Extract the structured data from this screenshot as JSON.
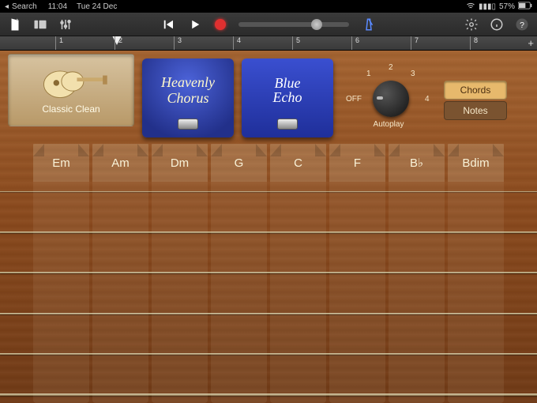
{
  "status": {
    "back": "Search",
    "time": "11:04",
    "date": "Tue 24 Dec",
    "battery": "57%"
  },
  "ruler": {
    "numbers": [
      "1",
      "2",
      "3",
      "4",
      "5",
      "6",
      "7",
      "8"
    ]
  },
  "instrument": {
    "name": "Classic Clean"
  },
  "pedals": {
    "one": {
      "line1": "Heavenly",
      "line2": "Chorus"
    },
    "two": {
      "line1": "Blue",
      "line2": "Echo"
    }
  },
  "autoplay": {
    "labels": {
      "off": "OFF",
      "n1": "1",
      "n2": "2",
      "n3": "3",
      "n4": "4"
    },
    "title": "Autoplay"
  },
  "mode": {
    "chords": "Chords",
    "notes": "Notes",
    "active": "chords"
  },
  "chords": [
    "Em",
    "Am",
    "Dm",
    "G",
    "C",
    "F",
    "B♭",
    "Bdim"
  ]
}
